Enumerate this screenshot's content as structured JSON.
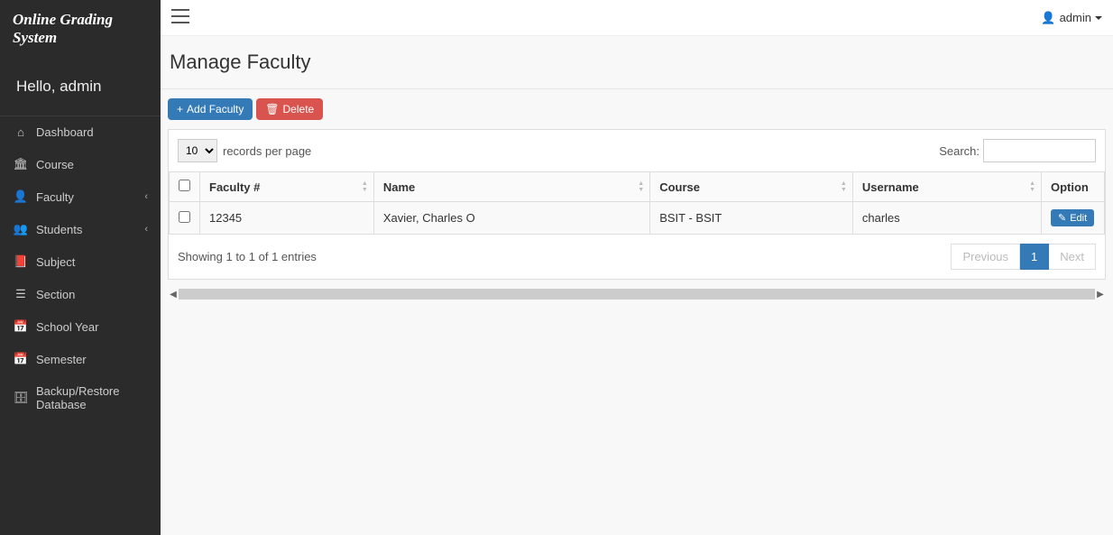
{
  "brand": "Online Grading System",
  "greeting": "Hello, admin",
  "user_menu_label": "admin",
  "sidebar": {
    "items": [
      {
        "icon": "dashboard-icon",
        "label": "Dashboard",
        "has_children": false
      },
      {
        "icon": "institution-icon",
        "label": "Course",
        "has_children": false
      },
      {
        "icon": "user-icon",
        "label": "Faculty",
        "has_children": true
      },
      {
        "icon": "students-icon",
        "label": "Students",
        "has_children": true
      },
      {
        "icon": "book-icon",
        "label": "Subject",
        "has_children": false
      },
      {
        "icon": "list-icon",
        "label": "Section",
        "has_children": false
      },
      {
        "icon": "calendar-icon",
        "label": "School Year",
        "has_children": false
      },
      {
        "icon": "calendar-icon",
        "label": "Semester",
        "has_children": false
      },
      {
        "icon": "database-icon",
        "label": "Backup/Restore Database",
        "has_children": false
      }
    ]
  },
  "page_title": "Manage Faculty",
  "buttons": {
    "add_faculty": "Add Faculty",
    "delete": "Delete",
    "edit": "Edit"
  },
  "table": {
    "length_options": [
      "10"
    ],
    "length_value": "10",
    "length_suffix": "records per page",
    "search_label": "Search:",
    "search_value": "",
    "columns": [
      "Faculty #",
      "Name",
      "Course",
      "Username",
      "Option"
    ],
    "rows": [
      {
        "faculty_no": "12345",
        "name": "Xavier, Charles O",
        "course": "BSIT - BSIT",
        "username": "charles"
      }
    ],
    "info": "Showing 1 to 1 of 1 entries",
    "pagination": {
      "previous": "Previous",
      "next": "Next",
      "current": "1"
    }
  },
  "icons": {
    "dashboard-icon": "⌂",
    "institution-icon": "🏛",
    "user-icon": "👤",
    "students-icon": "👥",
    "book-icon": "📕",
    "list-icon": "☰",
    "calendar-icon": "📅",
    "database-icon": "🗄",
    "plus-icon": "+",
    "trash-icon": "🗑",
    "pencil-icon": "✎",
    "menu-icon": "☰",
    "person-icon": "👤"
  }
}
